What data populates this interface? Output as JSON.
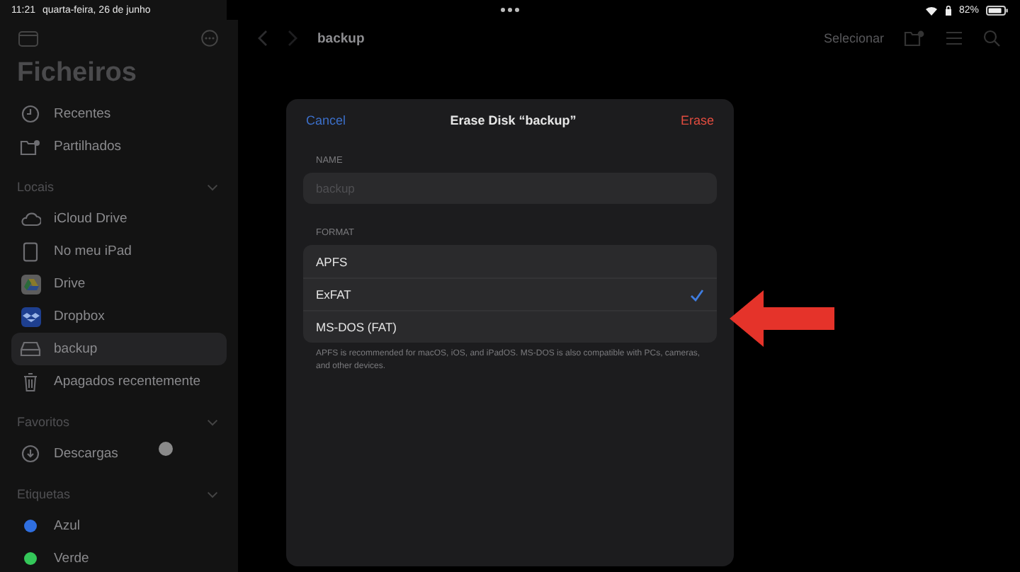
{
  "status_bar": {
    "time": "11:21",
    "date": "quarta-feira, 26 de junho",
    "battery": "82%"
  },
  "sidebar": {
    "title": "Ficheiros",
    "items": [
      {
        "kind": "recents",
        "label": "Recentes",
        "selected": false
      },
      {
        "kind": "shared",
        "label": "Partilhados",
        "selected": false
      }
    ],
    "sections": [
      {
        "title": "Locais",
        "expanded": true,
        "items": [
          {
            "kind": "cloud",
            "label": "iCloud Drive",
            "selected": false
          },
          {
            "kind": "ipad",
            "label": "No meu iPad",
            "selected": false
          },
          {
            "kind": "drive",
            "label": "Drive",
            "selected": false
          },
          {
            "kind": "dropbox",
            "label": "Dropbox",
            "selected": false
          },
          {
            "kind": "disk",
            "label": "backup",
            "selected": true
          },
          {
            "kind": "trash",
            "label": "Apagados recentemente",
            "selected": false
          }
        ]
      },
      {
        "title": "Favoritos",
        "expanded": true,
        "items": [
          {
            "kind": "downloads",
            "label": "Descargas",
            "selected": false
          }
        ]
      },
      {
        "title": "Etiquetas",
        "expanded": true,
        "items": [
          {
            "kind": "tag",
            "label": "Azul",
            "color": "#2f6fe0",
            "selected": false
          },
          {
            "kind": "tag",
            "label": "Verde",
            "color": "#34c759",
            "selected": false
          }
        ]
      }
    ]
  },
  "toolbar": {
    "title": "backup",
    "select": "Selecionar"
  },
  "dialog": {
    "title": "Erase Disk “backup”",
    "cancel": "Cancel",
    "confirm": "Erase",
    "name_field": {
      "label": "NAME",
      "placeholder": "backup"
    },
    "format": {
      "label": "FORMAT",
      "options": [
        {
          "label": "APFS",
          "selected": false
        },
        {
          "label": "ExFAT",
          "selected": true
        },
        {
          "label": "MS-DOS (FAT)",
          "selected": false
        }
      ],
      "footnote": "APFS is recommended for macOS, iOS, and iPadOS. MS-DOS is also compatible with PCs, cameras, and other devices."
    }
  }
}
